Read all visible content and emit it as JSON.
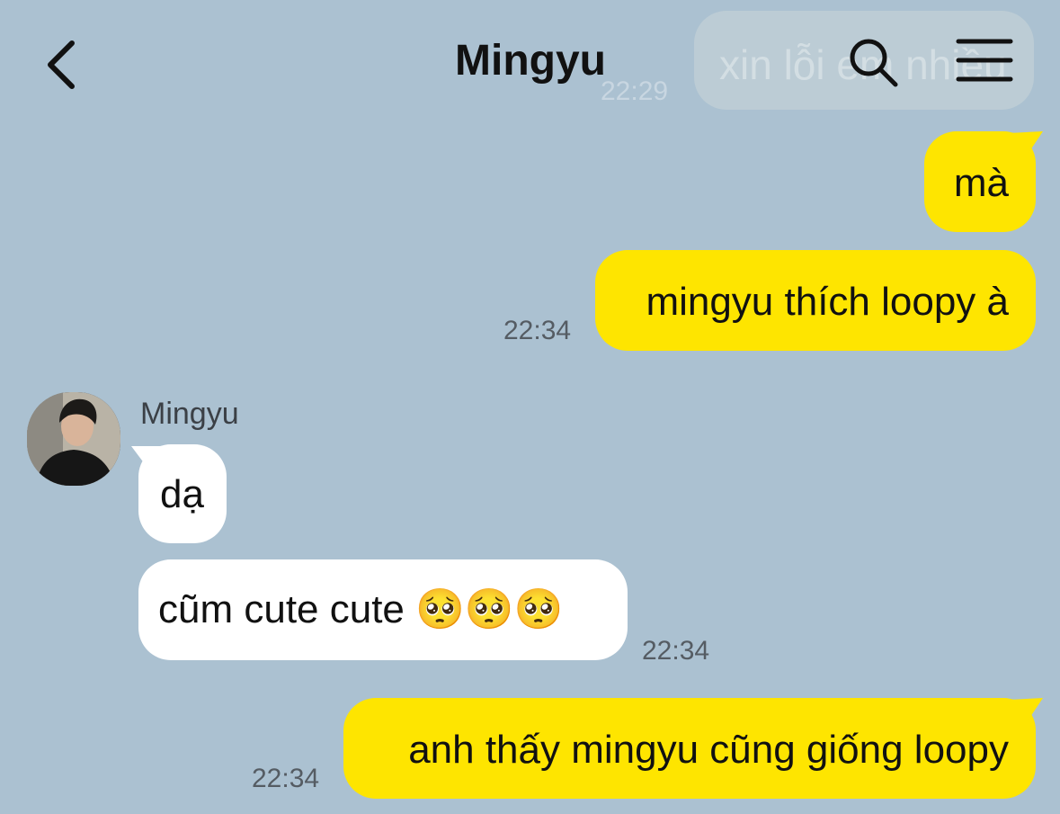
{
  "header": {
    "title": "Mingyu",
    "back_icon": "chevron-left-icon",
    "search_icon": "search-icon",
    "menu_icon": "hamburger-menu-icon"
  },
  "ghost_message": {
    "text": "xin lỗi em nhiều",
    "time": "22:29"
  },
  "messages": [
    {
      "from": "me",
      "text": "mà",
      "time": ""
    },
    {
      "from": "me",
      "text": "mingyu thích loopy à",
      "time": "22:34"
    },
    {
      "from": "them",
      "sender": "Mingyu",
      "text": "dạ",
      "time": ""
    },
    {
      "from": "them",
      "text": "cũm cute cute 🥺🥺🥺",
      "time": "22:34"
    },
    {
      "from": "me",
      "text": "anh thấy mingyu cũng giống loopy",
      "time": "22:34"
    }
  ],
  "colors": {
    "background": "#abc1d1",
    "my_bubble": "#fee500",
    "their_bubble": "#ffffff"
  }
}
